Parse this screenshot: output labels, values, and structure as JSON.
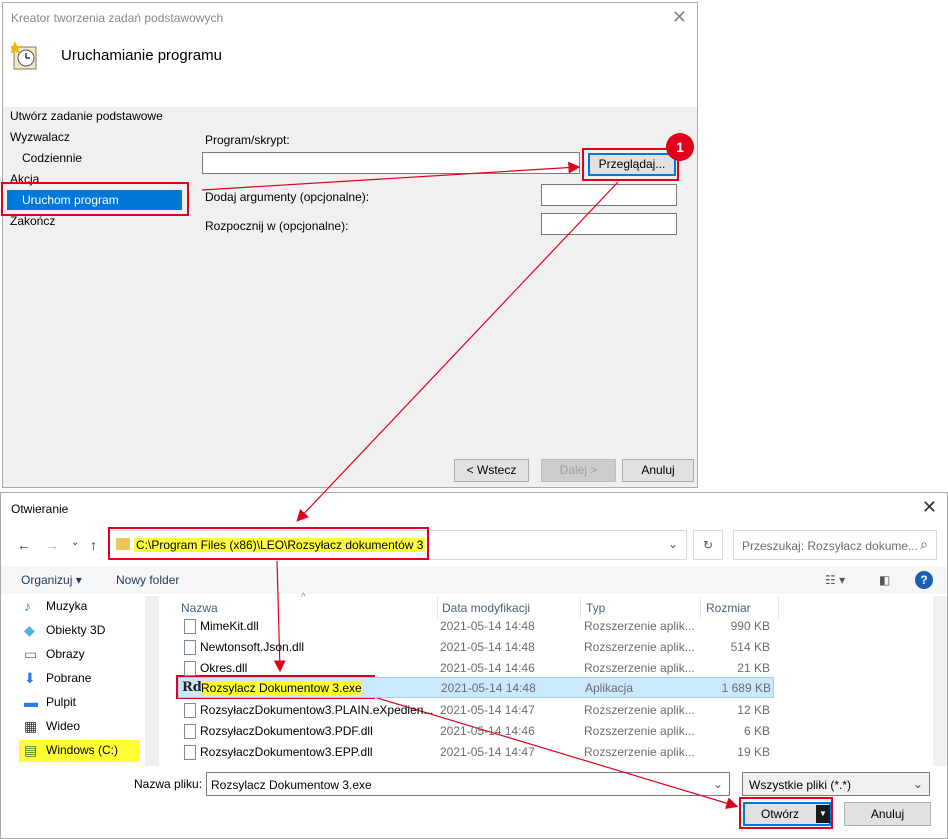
{
  "wizard": {
    "title": "Kreator tworzenia zadań podstawowych",
    "heading": "Uruchamianie programu",
    "nav": {
      "create_basic": "Utwórz zadanie podstawowe",
      "trigger": "Wyzwalacz",
      "daily": "Codziennie",
      "action": "Akcja",
      "run_program": "Uruchom program",
      "finish": "Zakończ"
    },
    "program_label": "Program/skrypt:",
    "program_value": "",
    "browse_button": "Przeglądaj...",
    "args_label": "Dodaj argumenty (opcjonalne):",
    "start_in_label": "Rozpocznij w (opcjonalne):",
    "back_button": "< Wstecz",
    "next_button": "Dalej >",
    "cancel_button": "Anuluj",
    "step_badge": "1"
  },
  "open_dialog": {
    "title": "Otwieranie",
    "address_path": "C:\\Program Files (x86)\\LEO\\Rozsyłacz dokumentów 3",
    "search_placeholder": "Przeszukaj: Rozsyłacz dokume...",
    "organize": "Organizuj",
    "new_folder": "Nowy folder",
    "sidebar": [
      {
        "label": "Muzyka",
        "icon": "music-icon"
      },
      {
        "label": "Obiekty 3D",
        "icon": "objects3d-icon"
      },
      {
        "label": "Obrazy",
        "icon": "pictures-icon"
      },
      {
        "label": "Pobrane",
        "icon": "downloads-icon"
      },
      {
        "label": "Pulpit",
        "icon": "desktop-icon"
      },
      {
        "label": "Wideo",
        "icon": "video-icon"
      },
      {
        "label": "Windows (C:)",
        "icon": "drive-icon"
      }
    ],
    "columns": {
      "name": "Nazwa",
      "modified": "Data modyfikacji",
      "type": "Typ",
      "size": "Rozmiar"
    },
    "files": [
      {
        "name": "MimeKit.dll",
        "modified": "2021-05-14 14:48",
        "type": "Rozszerzenie aplik...",
        "size": "990 KB"
      },
      {
        "name": "Newtonsoft.Json.dll",
        "modified": "2021-05-14 14:48",
        "type": "Rozszerzenie aplik...",
        "size": "514 KB"
      },
      {
        "name": "Okres.dll",
        "modified": "2021-05-14 14:46",
        "type": "Rozszerzenie aplik...",
        "size": "21 KB"
      },
      {
        "name": "Rozsylacz Dokumentow 3.exe",
        "modified": "2021-05-14 14:48",
        "type": "Aplikacja",
        "size": "1 689 KB"
      },
      {
        "name": "RozsyłaczDokumentow3.PLAIN.eXpedien...",
        "modified": "2021-05-14 14:47",
        "type": "Rozszerzenie aplik...",
        "size": "12 KB"
      },
      {
        "name": "RozsyłaczDokumentow3.PDF.dll",
        "modified": "2021-05-14 14:46",
        "type": "Rozszerzenie aplik...",
        "size": "6 KB"
      },
      {
        "name": "RozsyłaczDokumentow3.EPP.dll",
        "modified": "2021-05-14 14:47",
        "type": "Rozszerzenie aplik...",
        "size": "19 KB"
      }
    ],
    "filename_label": "Nazwa pliku:",
    "filename_value": "Rozsylacz Dokumentow 3.exe",
    "filter_value": "Wszystkie pliki (*.*)",
    "open_button": "Otwórz",
    "cancel_button": "Anuluj"
  },
  "colors": {
    "accent": "#0078d7",
    "annotation_red": "#e0001b",
    "highlight_yellow": "#ffff33",
    "selection": "#cce8ff"
  }
}
